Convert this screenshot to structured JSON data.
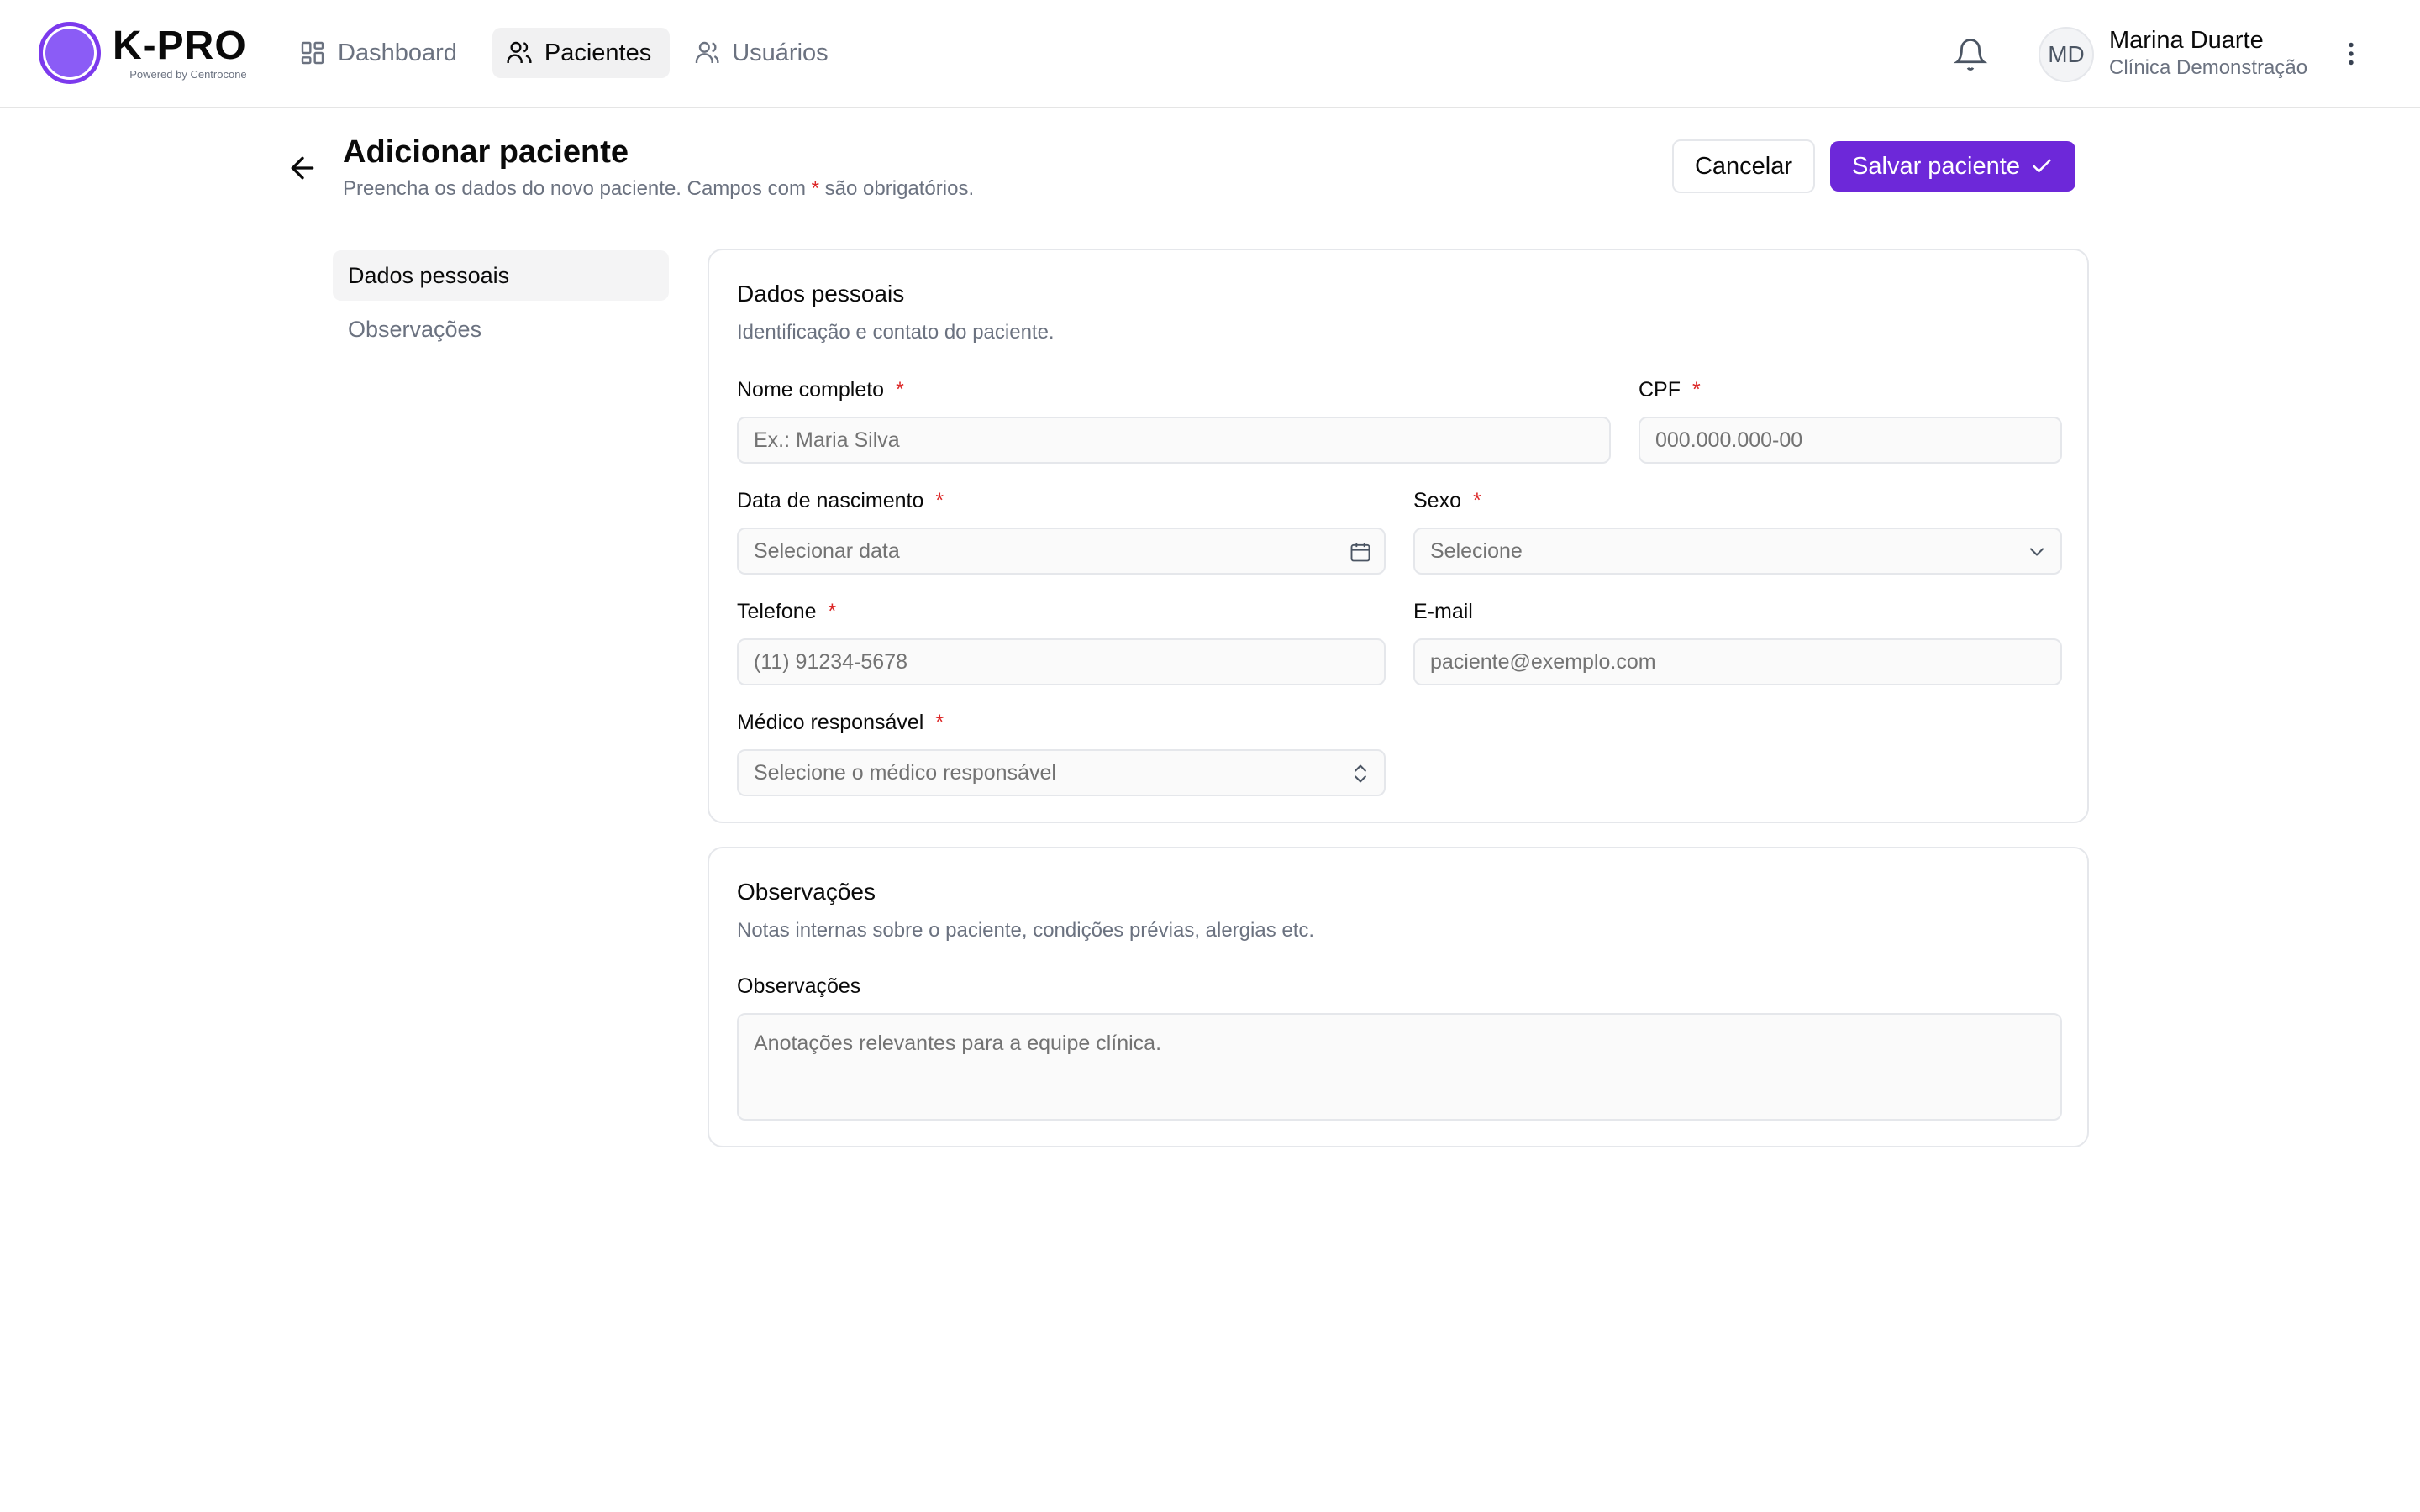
{
  "brand": {
    "name": "K-PRO",
    "tagline": "Powered by Centrocone"
  },
  "nav": [
    {
      "label": "Dashboard",
      "icon": "dashboard-icon",
      "active": false
    },
    {
      "label": "Pacientes",
      "icon": "users-icon",
      "active": true
    },
    {
      "label": "Usuários",
      "icon": "user-icon",
      "active": false
    }
  ],
  "user": {
    "initials": "MD",
    "name": "Marina Duarte",
    "organization": "Clínica Demonstração"
  },
  "page": {
    "title": "Adicionar paciente",
    "subtitle_before": "Preencha os dados do novo paciente. Campos com ",
    "subtitle_required_mark": "*",
    "subtitle_after": " são obrigatórios.",
    "cancel_label": "Cancelar",
    "save_label": "Salvar paciente"
  },
  "sections_nav": [
    {
      "label": "Dados pessoais",
      "active": true
    },
    {
      "label": "Observações",
      "active": false
    }
  ],
  "personal": {
    "title": "Dados pessoais",
    "description": "Identificação e contato do paciente.",
    "required_mark": "*",
    "fields": {
      "name": {
        "label": "Nome completo",
        "placeholder": "Ex.: Maria Silva",
        "required": true
      },
      "cpf": {
        "label": "CPF",
        "placeholder": "000.000.000-00",
        "required": true
      },
      "birthdate": {
        "label": "Data de nascimento",
        "placeholder": "Selecionar data",
        "required": true
      },
      "sex": {
        "label": "Sexo",
        "placeholder": "Selecione",
        "required": true
      },
      "phone": {
        "label": "Telefone",
        "placeholder": "(11) 91234-5678",
        "required": true
      },
      "email": {
        "label": "E-mail",
        "placeholder": "paciente@exemplo.com",
        "required": false
      },
      "doctor": {
        "label": "Médico responsável",
        "placeholder": "Selecione o médico responsável",
        "required": true
      }
    }
  },
  "notes": {
    "title": "Observações",
    "description": "Notas internas sobre o paciente, condições prévias, alergias etc.",
    "field_label": "Observações",
    "placeholder": "Anotações relevantes para a equipe clínica."
  },
  "colors": {
    "primary": "#6d28d9",
    "brand_ring": "#7c3aed",
    "brand_fill": "#8b5cf6",
    "required": "#dc2626",
    "muted_text": "#6b7280",
    "border": "#e5e7eb"
  }
}
